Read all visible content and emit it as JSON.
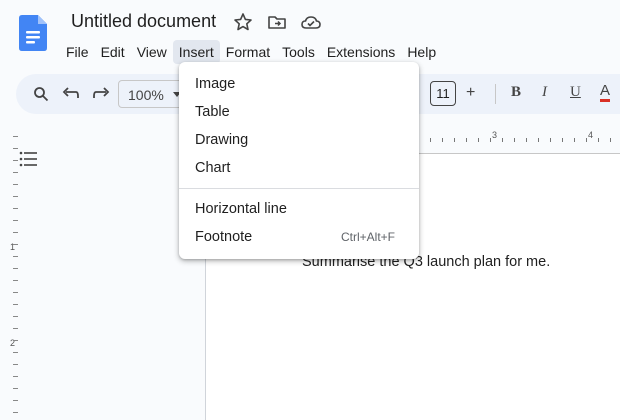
{
  "document": {
    "title": "Untitled document",
    "body_text": "Summarise the Q3 launch plan for me."
  },
  "title_icons": [
    "star-icon",
    "move-to-folder-icon",
    "cloud-status-icon"
  ],
  "menubar": {
    "items": [
      "File",
      "Edit",
      "View",
      "Insert",
      "Format",
      "Tools",
      "Extensions",
      "Help"
    ],
    "active": "Insert"
  },
  "toolbar": {
    "zoom": "100%",
    "font_size": "11",
    "increase_font": "+",
    "bold": "B",
    "italic": "I",
    "underline": "U",
    "text_color": "A",
    "text_color_accent": "#d93025"
  },
  "ruler": {
    "h_numbers": [
      "3",
      "4"
    ],
    "v_numbers": [
      "1",
      "2"
    ]
  },
  "insert_menu": {
    "items": [
      {
        "label": "Image",
        "shortcut": ""
      },
      {
        "label": "Table",
        "shortcut": ""
      },
      {
        "label": "Drawing",
        "shortcut": ""
      },
      {
        "label": "Chart",
        "shortcut": ""
      },
      {
        "label": "Horizontal line",
        "shortcut": ""
      },
      {
        "label": "Footnote",
        "shortcut": "Ctrl+Alt+F"
      }
    ]
  },
  "colors": {
    "docs_blue": "#4285f4",
    "toolbar_bg": "#edf2fa",
    "app_bg": "#f9fbfd"
  }
}
